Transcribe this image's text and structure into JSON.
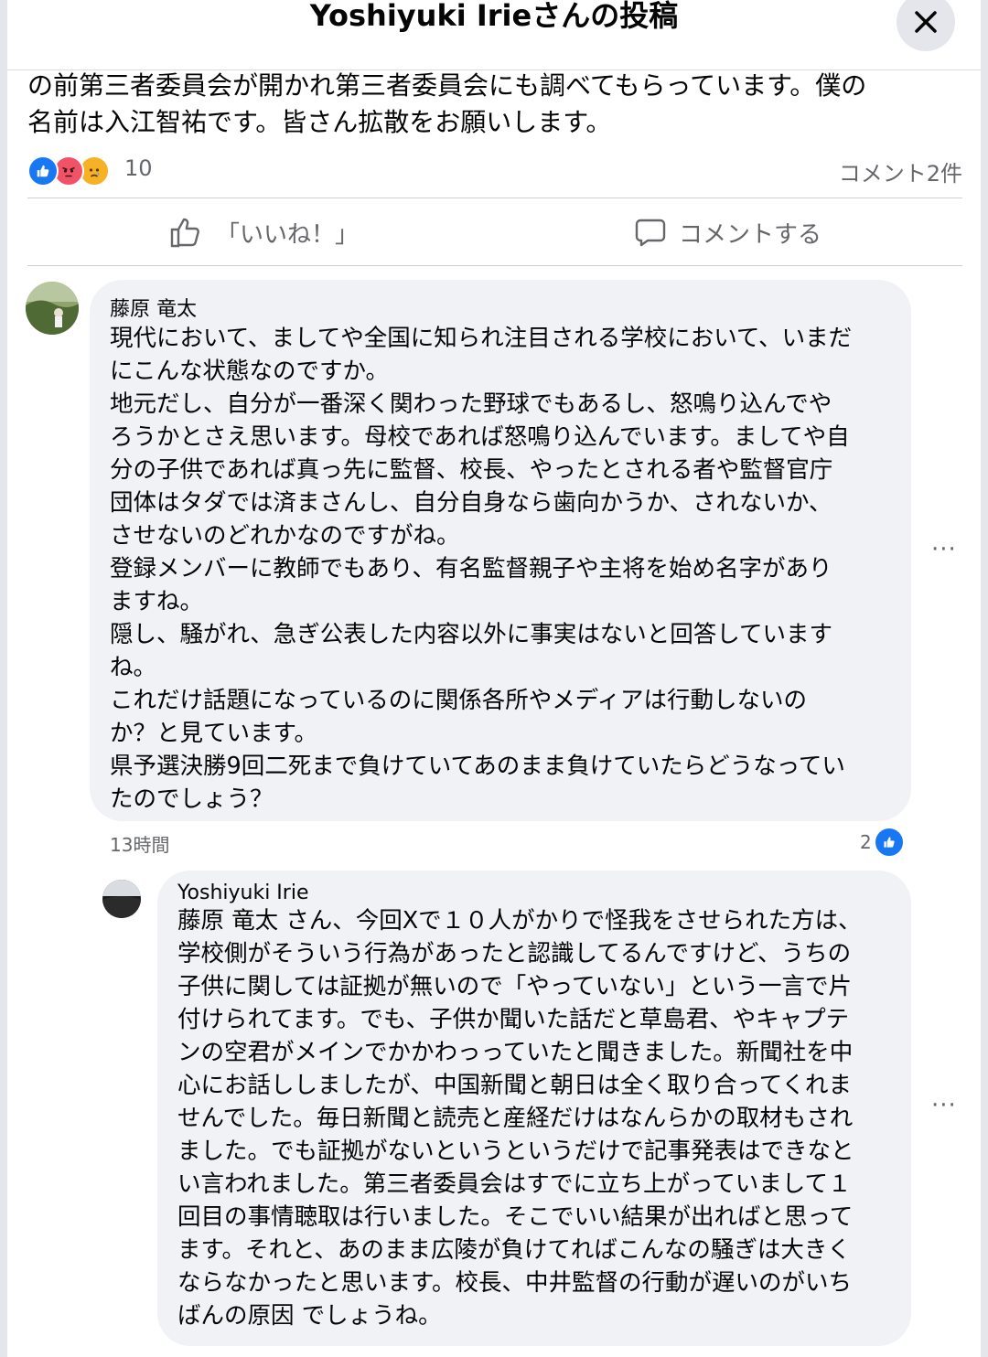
{
  "header": {
    "title": "Yoshiyuki Irieさんの投稿"
  },
  "post": {
    "text_line1": "の前第三者委員会が開かれ第三者委員会にも調べてもらっています。僕の",
    "text_line2": "名前は入江智祐です。皆さん拡散をお願いします。",
    "reaction_count": "10",
    "comment_count": "コメント2件"
  },
  "actions": {
    "like_label": "「いいね！」",
    "comment_label": "コメントする"
  },
  "comments": [
    {
      "author": "藤原 竜太",
      "text": "現代において、ましてや全国に知られ注目される学校において、いまだ\nにこんな状態なのですか。\n地元だし、自分が一番深く関わった野球でもあるし、怒鳴り込んでや\nろうかとさえ思います。母校であれば怒鳴り込んでいます。ましてや自\n分の子供であれば真っ先に監督、校長、やったとされる者や監督官庁\n団体はタダでは済まさんし、自分自身なら歯向かうか、されないか、\nさせないのどれかなのですがね。\n登録メンバーに教師でもあり、有名監督親子や主将を始め名字があり\nますね。\n隠し、騒がれ、急ぎ公表した内容以外に事実はないと回答しています\nね。\nこれだけ話題になっているのに関係各所やメディアは行動しないの\nか？と見ています。\n県予選決勝9回二死まで負けていてあのまま負けていたらどうなってい\nたのでしょう？",
      "time": "13時間",
      "likes": "2"
    },
    {
      "author": "Yoshiyuki Irie",
      "text": "藤原 竜太 さん、今回Xで１０人がかりで怪我をさせられた方は、\n学校側がそういう行為があったと認識してるんですけど、うちの\n子供に関しては証拠が無いので「やっていない」という一言で片\n付けられてます。でも、子供か聞いた話だと草島君、やキャプテ\nンの空君がメインでかかわっっていたと聞きました。新聞社を中\n心にお話ししましたが、中国新聞と朝日は全く取り合ってくれま\nせんでした。毎日新聞と読売と産経だけはなんらかの取材もされ\nました。でも証拠がないというというだけで記事発表はできなと\nい言われました。第三者委員会はすでに立ち上がっていまして１\n回目の事情聴取は行いました。そこでいい結果が出ればと思って\nます。それと、あのまま広陵が負けてればこんなの騒ぎは大きく\nならなかったと思います。校長、中井監督の行動が遅いのがいち\nばんの原因 でしょうね。"
    }
  ],
  "more_label": "···",
  "colors": {
    "like_blue": "#1877f2",
    "angry": "#f25268",
    "sad": "#f7b125"
  }
}
